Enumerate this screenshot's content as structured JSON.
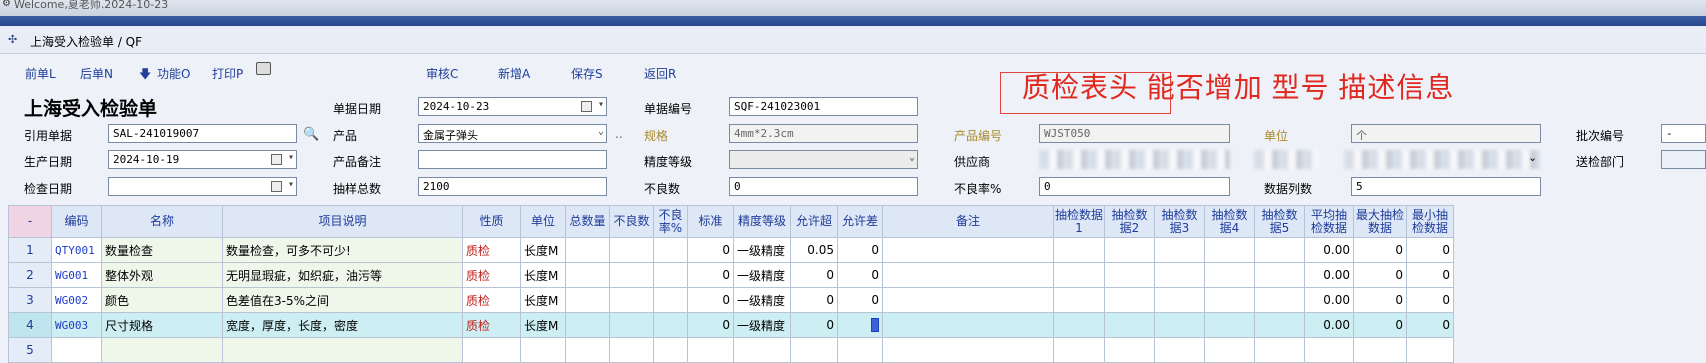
{
  "app": {
    "welcome": "Welcome,夏老师.2024-10-23"
  },
  "window": {
    "title": "上海受入检验单 / QF"
  },
  "toolbar": {
    "prev": "前单L",
    "next": "后单N",
    "func": "功能O",
    "print": "打印P",
    "audit": "审核C",
    "add": "新增A",
    "save": "保存S",
    "back": "返回R"
  },
  "form": {
    "title": "上海受入检验单",
    "labels": {
      "ref_no": "引用单据",
      "prod_date": "生产日期",
      "check_date": "检查日期",
      "doc_date": "单据日期",
      "product": "产品",
      "product_note": "产品备注",
      "sample_total": "抽样总数",
      "doc_no": "单据编号",
      "spec": "规格",
      "precision": "精度等级",
      "defect_qty": "不良数",
      "product_code": "产品编号",
      "supplier": "供应商",
      "defect_rate": "不良率%",
      "unit": "单位",
      "data_cols": "数据列数",
      "batch_no": "批次编号",
      "send_dept": "送检部门"
    },
    "values": {
      "ref_no": "SAL-241019007",
      "prod_date": "2024-10-19",
      "check_date": "",
      "doc_date": "2024-10-23",
      "product": "金属子弹头",
      "product_note": "",
      "sample_total": "2100",
      "doc_no": "SQF-241023001",
      "spec": "4mm*2.3cm",
      "precision": "",
      "defect_qty": "0",
      "product_code": "WJST050",
      "defect_rate": "0",
      "unit": "个",
      "data_cols": "5",
      "batch_no": "-",
      "send_dept": ""
    }
  },
  "annotation": {
    "text": "质检表头  能否增加 型号 描述信息"
  },
  "table": {
    "corner": "-",
    "headers": [
      "编码",
      "名称",
      "项目说明",
      "性质",
      "单位",
      "总数量",
      "不良数",
      "不良率%",
      "标准",
      "精度等级",
      "允许超",
      "允许差",
      "备注",
      "抽检数据1",
      "抽检数据2",
      "抽检数据3",
      "抽检数据4",
      "抽检数据5",
      "平均抽检数据",
      "最大抽检数据",
      "最小抽检数据"
    ],
    "rows": [
      {
        "n": "1",
        "code": "QTY001",
        "name": "数量检查",
        "desc": "数量检查，可多不可少!",
        "nature": "质检",
        "unit": "长度M",
        "total": "",
        "defect": "",
        "rate": "",
        "std": "0",
        "grade": "一级精度",
        "over": "0.05",
        "under": "0",
        "note": "",
        "d1": "",
        "d2": "",
        "d3": "",
        "d4": "",
        "d5": "",
        "avg": "0.00",
        "max": "0",
        "min": "0"
      },
      {
        "n": "2",
        "code": "WG001",
        "name": "整体外观",
        "desc": "无明显瑕疵，如织疵，油污等",
        "nature": "质检",
        "unit": "长度M",
        "total": "",
        "defect": "",
        "rate": "",
        "std": "0",
        "grade": "一级精度",
        "over": "0",
        "under": "0",
        "note": "",
        "d1": "",
        "d2": "",
        "d3": "",
        "d4": "",
        "d5": "",
        "avg": "0.00",
        "max": "0",
        "min": "0"
      },
      {
        "n": "3",
        "code": "WG002",
        "name": "颜色",
        "desc": "色差值在3-5%之间",
        "nature": "质检",
        "unit": "长度M",
        "total": "",
        "defect": "",
        "rate": "",
        "std": "0",
        "grade": "一级精度",
        "over": "0",
        "under": "0",
        "note": "",
        "d1": "",
        "d2": "",
        "d3": "",
        "d4": "",
        "d5": "",
        "avg": "0.00",
        "max": "0",
        "min": "0"
      },
      {
        "n": "4",
        "code": "WG003",
        "name": "尺寸规格",
        "desc": "宽度，厚度，长度，密度",
        "nature": "质检",
        "unit": "长度M",
        "total": "",
        "defect": "",
        "rate": "",
        "std": "0",
        "grade": "一级精度",
        "over": "0",
        "under": "0",
        "note": "",
        "d1": "",
        "d2": "",
        "d3": "",
        "d4": "",
        "d5": "",
        "avg": "0.00",
        "max": "0",
        "min": "0"
      },
      {
        "n": "5",
        "code": "",
        "name": "",
        "desc": "",
        "nature": "",
        "unit": "",
        "total": "",
        "defect": "",
        "rate": "",
        "std": "",
        "grade": "",
        "over": "",
        "under": "",
        "note": "",
        "d1": "",
        "d2": "",
        "d3": "",
        "d4": "",
        "d5": "",
        "avg": "",
        "max": "",
        "min": ""
      }
    ]
  }
}
